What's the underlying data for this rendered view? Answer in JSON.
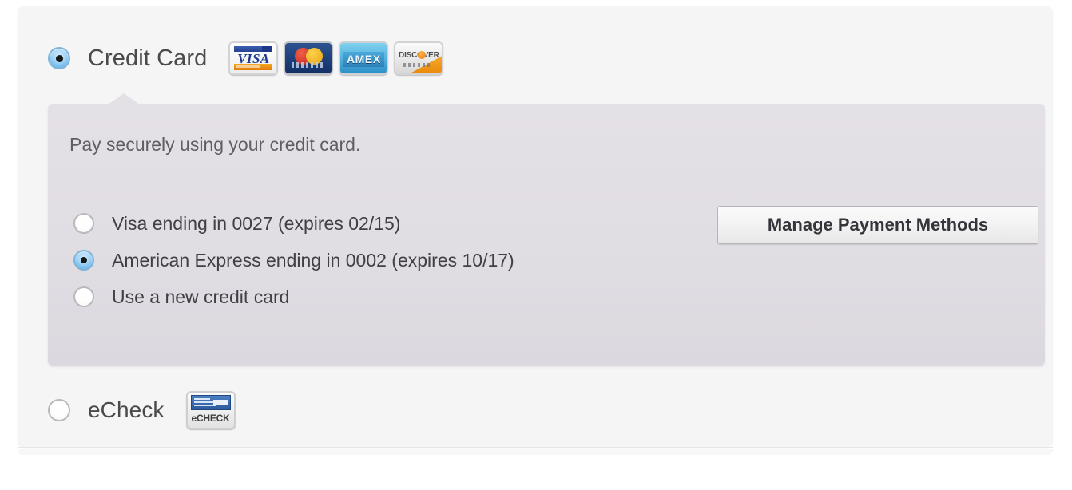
{
  "payment_methods": [
    {
      "id": "credit-card",
      "label": "Credit Card",
      "selected": true,
      "icons": [
        "visa-icon",
        "mastercard-icon",
        "amex-icon",
        "discover-icon"
      ],
      "icon_labels": {
        "visa": "VISA",
        "amex": "AMEX",
        "discover": "DISCOVER"
      }
    },
    {
      "id": "echeck",
      "label": "eCheck",
      "selected": false,
      "icons": [
        "echeck-icon"
      ],
      "icon_labels": {
        "echeck": "eCHECK"
      }
    }
  ],
  "credit_card_panel": {
    "intro_text": "Pay securely using your credit card.",
    "saved_cards": [
      {
        "label": "Visa ending in 0027 (expires 02/15)",
        "selected": false
      },
      {
        "label": "American Express ending in 0002 (expires 10/17)",
        "selected": true
      },
      {
        "label": "Use a new credit card",
        "selected": false
      }
    ],
    "manage_button_label": "Manage Payment Methods"
  },
  "colors": {
    "page_background": "#ffffff",
    "card_background": "#f5f5f6",
    "panel_background": "#e2dfe5",
    "heading_text": "#4a4a4a",
    "body_text": "#5e5e63",
    "option_text": "#3f3f44",
    "radio_selected_blue": "#8ecaf1",
    "button_text": "#34343a",
    "button_border": "#b4b4b8",
    "visa_blue": "#1d3a8f",
    "visa_orange": "#e07c08",
    "mastercard_blue": "#123066",
    "mastercard_red": "#c3241c",
    "mastercard_yellow": "#e8a414",
    "amex_blue": "#2b8fc8",
    "discover_orange": "#ef7d10",
    "echeck_blue": "#2c5a9c"
  }
}
